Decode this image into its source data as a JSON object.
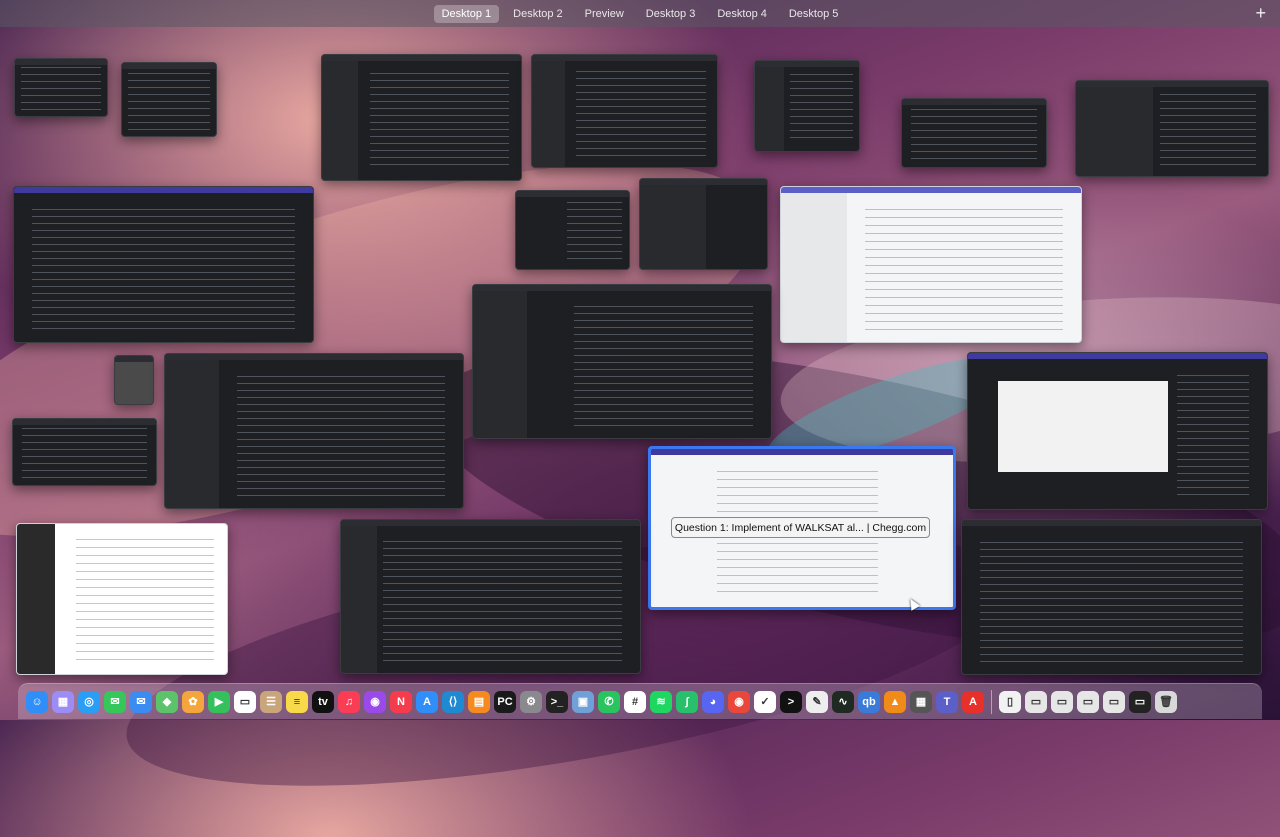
{
  "spaces_bar": {
    "tabs": [
      {
        "label": "Desktop 1",
        "active": true
      },
      {
        "label": "Desktop 2"
      },
      {
        "label": "Preview"
      },
      {
        "label": "Desktop 3"
      },
      {
        "label": "Desktop 4"
      },
      {
        "label": "Desktop 5"
      }
    ],
    "add_icon": "+"
  },
  "hovered_window_title": "Question 1:   Implement of WALKSAT al... | Chegg.com",
  "dock": {
    "icons": [
      {
        "name": "finder-icon",
        "color": "#2f8ef7",
        "glyph": "☺"
      },
      {
        "name": "launchpad-icon",
        "color": "#9c8cf5",
        "glyph": "▦"
      },
      {
        "name": "safari-icon",
        "color": "#2a9df4",
        "glyph": "◎"
      },
      {
        "name": "messages-icon",
        "color": "#35c759",
        "glyph": "✉"
      },
      {
        "name": "mail-icon",
        "color": "#3b8cf0",
        "glyph": "✉"
      },
      {
        "name": "maps-icon",
        "color": "#5cc36b",
        "glyph": "◆"
      },
      {
        "name": "photos-icon",
        "color": "#f4a63c",
        "glyph": "✿"
      },
      {
        "name": "facetime-icon",
        "color": "#34c15b",
        "glyph": "▶"
      },
      {
        "name": "calendar-icon",
        "color": "#ffffff",
        "glyph": "▭"
      },
      {
        "name": "contacts-icon",
        "color": "#c9a57b",
        "glyph": "☰"
      },
      {
        "name": "notes-icon",
        "color": "#f8d94a",
        "glyph": "≡"
      },
      {
        "name": "tv-icon",
        "color": "#111111",
        "glyph": "tv"
      },
      {
        "name": "music-icon",
        "color": "#fa3c55",
        "glyph": "♫"
      },
      {
        "name": "podcasts-icon",
        "color": "#9a4ae8",
        "glyph": "◉"
      },
      {
        "name": "news-icon",
        "color": "#f43c4c",
        "glyph": "N"
      },
      {
        "name": "app-store-icon",
        "color": "#2f8ef7",
        "glyph": "A"
      },
      {
        "name": "vscode-icon",
        "color": "#1f8ad2",
        "glyph": "⟨⟩"
      },
      {
        "name": "books-icon",
        "color": "#f58a1f",
        "glyph": "▤"
      },
      {
        "name": "pycharm-icon",
        "color": "#1a1a1a",
        "glyph": "PC"
      },
      {
        "name": "system-settings-icon",
        "color": "#8a8a8e",
        "glyph": "⚙"
      },
      {
        "name": "terminal-icon",
        "color": "#222222",
        "glyph": ">_"
      },
      {
        "name": "preview-icon",
        "color": "#6fa0d8",
        "glyph": "▣"
      },
      {
        "name": "whatsapp-icon",
        "color": "#29c35f",
        "glyph": "✆"
      },
      {
        "name": "slack-icon",
        "color": "#ffffff",
        "glyph": "#"
      },
      {
        "name": "spotify-icon",
        "color": "#1ed760",
        "glyph": "≋"
      },
      {
        "name": "mathematica-icon",
        "color": "#28c06a",
        "glyph": "∫"
      },
      {
        "name": "discord-icon",
        "color": "#5865f2",
        "glyph": "◕"
      },
      {
        "name": "chrome-icon",
        "color": "#e9473b",
        "glyph": "◉"
      },
      {
        "name": "tasks-icon",
        "color": "#ffffff",
        "glyph": "✓"
      },
      {
        "name": "console-icon",
        "color": "#111111",
        "glyph": ">"
      },
      {
        "name": "script-editor-icon",
        "color": "#eeeeee",
        "glyph": "✎"
      },
      {
        "name": "activity-monitor-icon",
        "color": "#1e2a22",
        "glyph": "∿"
      },
      {
        "name": "qbittorrent-icon",
        "color": "#3a7ad8",
        "glyph": "qb"
      },
      {
        "name": "vlc-icon",
        "color": "#f08a18",
        "glyph": "▲"
      },
      {
        "name": "calculator-icon",
        "color": "#555555",
        "glyph": "▦"
      },
      {
        "name": "teams-icon",
        "color": "#5b5fc7",
        "glyph": "T"
      },
      {
        "name": "acrobat-icon",
        "color": "#e8302a",
        "glyph": "A"
      }
    ],
    "right_icons": [
      {
        "name": "document-icon",
        "color": "#f2f2f2",
        "glyph": "▯"
      },
      {
        "name": "stack-1-icon",
        "color": "#e6e6e6",
        "glyph": "▭"
      },
      {
        "name": "stack-2-icon",
        "color": "#e6e6e6",
        "glyph": "▭"
      },
      {
        "name": "stack-3-icon",
        "color": "#e6e6e6",
        "glyph": "▭"
      },
      {
        "name": "stack-4-icon",
        "color": "#e6e6e6",
        "glyph": "▭"
      },
      {
        "name": "stack-5-icon",
        "color": "#222222",
        "glyph": "▭"
      },
      {
        "name": "trash-icon",
        "color": "#d9d9d9",
        "glyph": "🗑"
      }
    ]
  }
}
